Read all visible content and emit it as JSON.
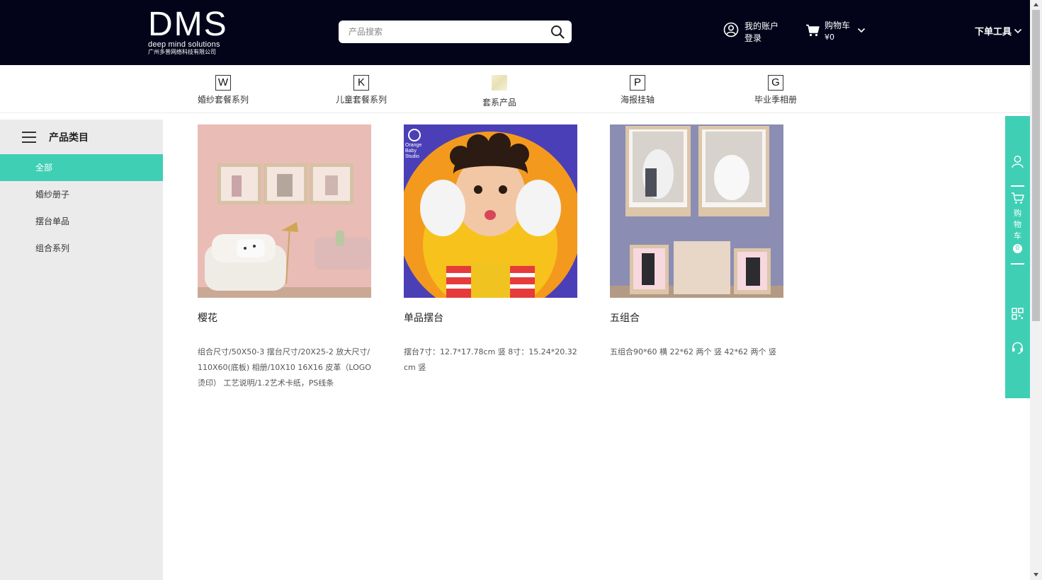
{
  "header": {
    "logo_text": "DMS",
    "logo_tagline": "deep mind solutions",
    "logo_company": "广州多普网络科技有限公司",
    "search_placeholder": "产品搜索",
    "account_line1": "我的账户",
    "account_line2": "登录",
    "cart_label": "购物车",
    "cart_amount": "¥0",
    "tools_label": "下单工具"
  },
  "categories": [
    {
      "badge": "W",
      "label": "婚纱套餐系列"
    },
    {
      "badge": "K",
      "label": "儿童套餐系列"
    },
    {
      "badge": "",
      "label": "套系产品"
    },
    {
      "badge": "P",
      "label": "海报挂轴"
    },
    {
      "badge": "G",
      "label": "毕业季相册"
    }
  ],
  "sidebar": {
    "title": "产品类目",
    "items": [
      {
        "label": "全部",
        "active": true
      },
      {
        "label": "婚纱册子",
        "active": false
      },
      {
        "label": "摆台单品",
        "active": false
      },
      {
        "label": "组合系列",
        "active": false
      }
    ]
  },
  "products": [
    {
      "name": "樱花",
      "desc": "组合尺寸/50X50-3 摆台尺寸/20X25-2 放大尺寸/110X60(底板) 相册/10X10 16X16 皮革（LOGO烫印） 工艺说明/1.2艺术卡纸，PS线条"
    },
    {
      "name": "单品摆台",
      "desc": "摆台7寸：12.7*17.78cm 竖 8寸：15.24*20.32cm 竖",
      "image_text": "Orange Baby Studio"
    },
    {
      "name": "五组合",
      "desc": "五组合90*60 横 22*62 两个 竖 42*62 两个 竖"
    }
  ],
  "floatbar": {
    "cart_label_chars": [
      "购",
      "物",
      "车"
    ],
    "cart_count": "0"
  },
  "colors": {
    "header_bg": "#03041a",
    "accent": "#3fcfb5",
    "sidebar_bg": "#ebebeb"
  }
}
